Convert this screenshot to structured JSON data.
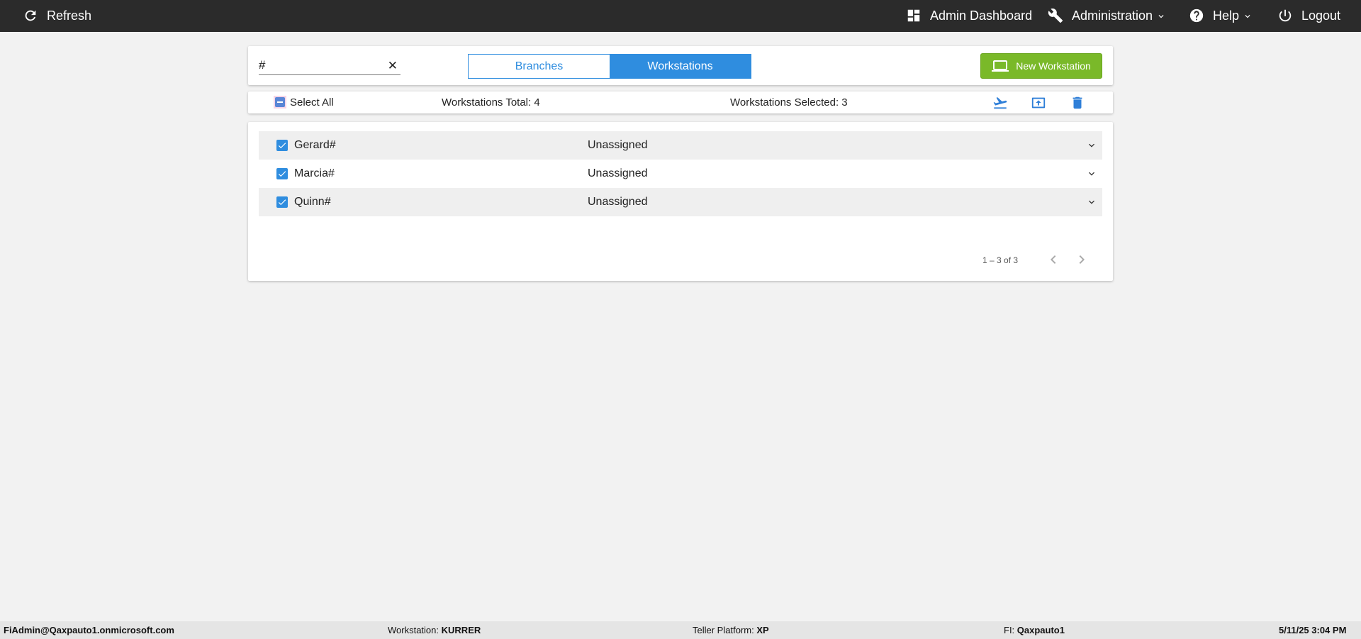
{
  "topbar": {
    "refresh_label": "Refresh",
    "admin_dashboard_label": "Admin Dashboard",
    "administration_label": "Administration",
    "help_label": "Help",
    "logout_label": "Logout"
  },
  "search": {
    "value": "#",
    "clear_glyph": "✕"
  },
  "toggle": {
    "branches_label": "Branches",
    "workstations_label": "Workstations",
    "active": "Workstations"
  },
  "new_button_label": "New Workstation",
  "selection_bar": {
    "select_all_label": "Select All",
    "total_text": "Workstations Total: 4",
    "selected_text": "Workstations Selected: 3",
    "actions": [
      "move-icon",
      "upload-icon",
      "delete-icon"
    ]
  },
  "rows": [
    {
      "name": "Gerard#",
      "status": "Unassigned",
      "checked": true
    },
    {
      "name": "Marcia#",
      "status": "Unassigned",
      "checked": true
    },
    {
      "name": "Quinn#",
      "status": "Unassigned",
      "checked": true
    }
  ],
  "pager": {
    "label": "1 – 3 of 3"
  },
  "footer": {
    "user": "FiAdmin@Qaxpauto1.onmicrosoft.com",
    "workstation_label": "Workstation:",
    "workstation_value": "KURRER",
    "teller_platform_label": "Teller Platform:",
    "teller_platform_value": "XP",
    "fi_label": "FI:",
    "fi_value": "Qaxpauto1",
    "datetime": "5/11/25 3:04 PM"
  },
  "colors": {
    "topbar": "#2b2b2b",
    "accent": "#2f8ddf",
    "new_button": "#7ab929",
    "background": "#f2f2f2"
  }
}
